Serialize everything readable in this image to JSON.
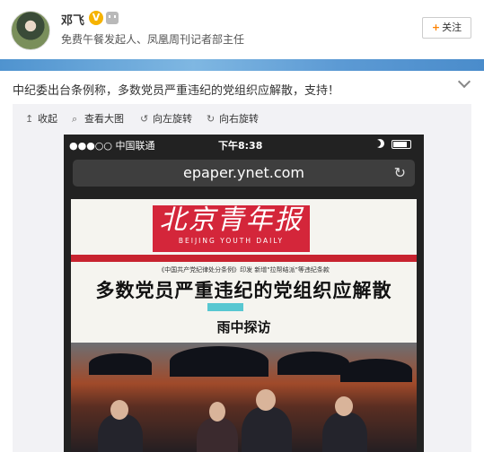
{
  "user": {
    "name": "邓飞",
    "bio": "免费午餐发起人、凤凰周刊记者部主任",
    "verified_icon": "verified-v-icon",
    "follow_label": "关注",
    "follow_plus": "+"
  },
  "post": {
    "text": "中纪委出台条例称，多数党员严重违纪的党组织应解散，支持！"
  },
  "media_toolbar": {
    "collapse": "收起",
    "view_large": "查看大图",
    "rotate_left": "向左旋转",
    "rotate_right": "向右旋转"
  },
  "phone": {
    "carrier": "●●●○○ 中国联通",
    "time": "下午8:38",
    "url": "epaper.ynet.com"
  },
  "newspaper": {
    "masthead": "北京青年报",
    "masthead_en": "BEIJING YOUTH DAILY",
    "subhead": "《中国共产党纪律处分条例》印发 新增\"拉帮结派\"等违纪条款",
    "headline": "多数党员严重违纪的党组织应解散",
    "section_title": "雨中探访"
  },
  "colors": {
    "accent": "#ff8200",
    "masthead_red": "#d4263a",
    "banner_blue": "#5c9ad4"
  }
}
